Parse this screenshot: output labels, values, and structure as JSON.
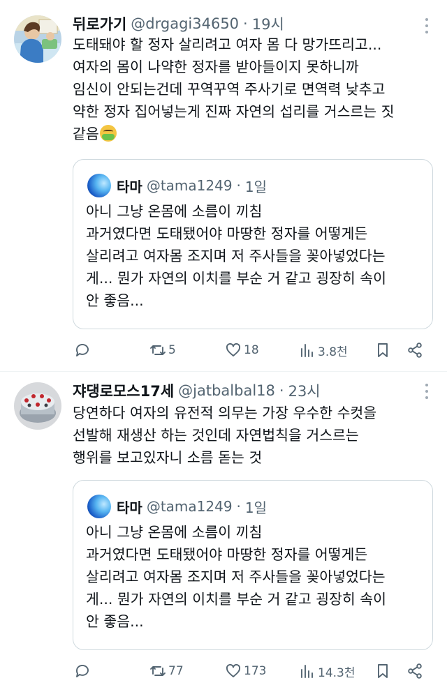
{
  "tweets": [
    {
      "name": "뒤로가기",
      "handle": "@drgagi34650",
      "time": "19시",
      "lines": [
        "도태돼야 할 정자 살리려고 여자 몸 다 망가뜨리고...",
        "여자의 몸이 나약한 정자를 받아들이지 못하니까",
        "임신이 안되는건데 꾸역꾸역 주사기로 면역력 낮추고",
        "약한 정자 집어넣는게 진짜 자연의 섭리를 거스르는 짓",
        "같음"
      ],
      "emoji": "nauseated-face-emoji",
      "quote": {
        "name": "타마",
        "handle": "@tama1249",
        "time": "1일",
        "lines": [
          "아니 그냥 온몸에 소름이 끼침",
          "과거였다면 도태됐어야 마땅한 정자를 어떻게든",
          "살리려고 여자몸 조지며 저 주사들을 꽂아넣었다는",
          "게... 뭔가 자연의 이치를 부순 거 같고 굉장히 속이",
          "안 좋음..."
        ]
      },
      "stats": {
        "replies": "",
        "retweets": "5",
        "likes": "18",
        "views": "3.8천"
      }
    },
    {
      "name": "쟈댕로모스17세",
      "handle": "@jatbalbal18",
      "time": "23시",
      "lines": [
        "당연하다 여자의 유전적 의무는 가장 우수한 수컷을",
        "선발해 재생산 하는 것인데 자연법칙을 거스르는",
        "행위를 보고있자니 소름 돋는 것"
      ],
      "quote": {
        "name": "타마",
        "handle": "@tama1249",
        "time": "1일",
        "lines": [
          "아니 그냥 온몸에 소름이 끼침",
          "과거였다면 도태됐어야 마땅한 정자를 어떻게든",
          "살리려고 여자몸 조지며 저 주사들을 꽂아넣었다는",
          "게... 뭔가 자연의 이치를 부순 거 같고 굉장히 속이",
          "안 좋음..."
        ]
      },
      "stats": {
        "replies": "",
        "retweets": "77",
        "likes": "173",
        "views": "14.3천"
      }
    }
  ],
  "separator": "·",
  "icons": {
    "reply": "reply-icon",
    "retweet": "retweet-icon",
    "like": "heart-icon",
    "views": "views-bar-chart-icon",
    "bookmark": "bookmark-icon",
    "share": "share-icon",
    "more": "more-vertical-icon"
  },
  "colors": {
    "text": "#0f1419",
    "secondary": "#536471",
    "border": "#cfd9de"
  }
}
